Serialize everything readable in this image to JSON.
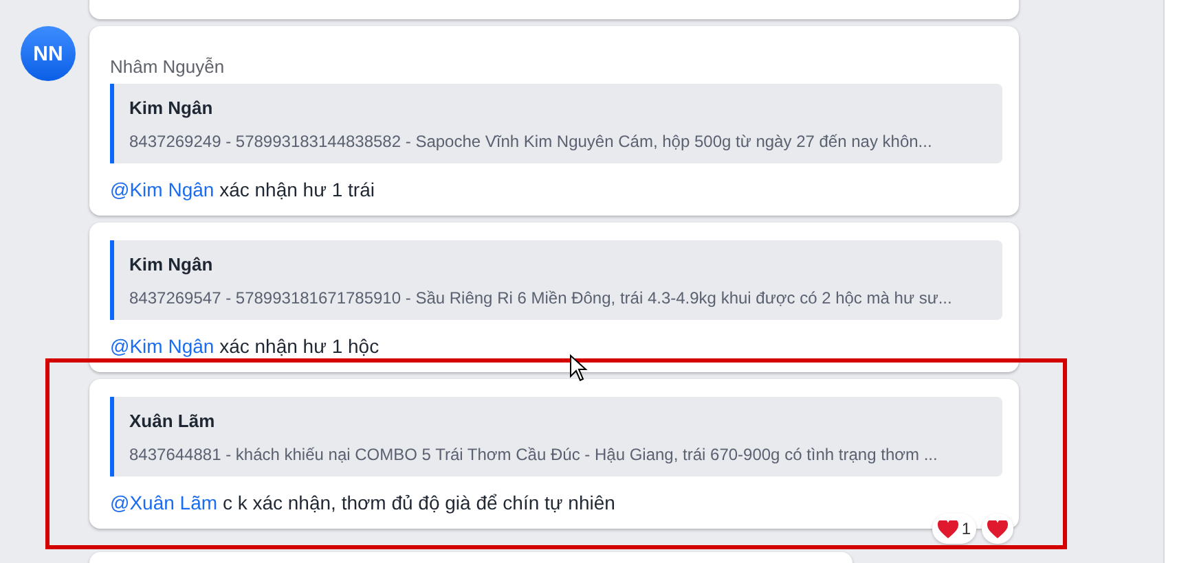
{
  "messages": [
    {
      "avatar": "NN",
      "sender": "Nhâm Nguyễn",
      "quote": {
        "author": "Kim Ngân",
        "text": "8437269249 - 578993183144838582 - Sapoche Vĩnh Kim Nguyên Cám, hộp 500g từ ngày 27 đến nay khôn..."
      },
      "mention": "@Kim Ngân",
      "text": "xác nhận hư 1 trái",
      "highlighted": false
    },
    {
      "quote": {
        "author": "Kim Ngân",
        "text": "8437269547 - 578993181671785910 - Sầu Riêng Ri 6 Miền Đông, trái 4.3-4.9kg khui được có 2 hộc mà hư sư..."
      },
      "mention": "@Kim Ngân",
      "text": "xác nhận hư 1 hộc",
      "highlighted": false
    },
    {
      "quote": {
        "author": "Xuân Lãm",
        "text": "8437644881 - khách khiếu nại COMBO 5 Trái Thơm Cầu Đúc - Hậu Giang, trái 670-900g có tình trạng thơm ..."
      },
      "mention": "@Xuân Lãm",
      "text": "c k xác nhận, thơm đủ độ già để chín tự nhiên",
      "highlighted": true,
      "reactions": [
        {
          "kind": "heart",
          "count": "1"
        },
        {
          "kind": "heart"
        }
      ]
    }
  ]
}
